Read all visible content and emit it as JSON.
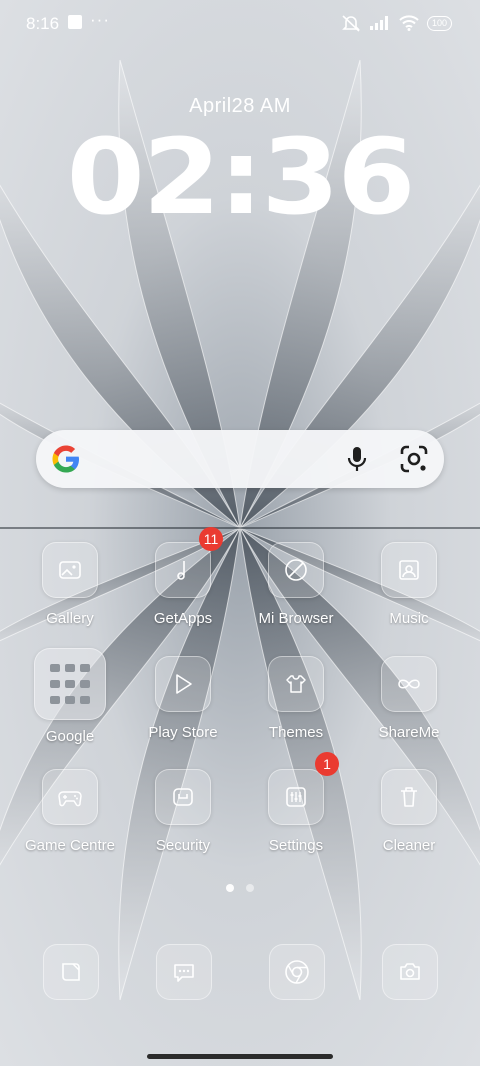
{
  "status": {
    "time": "8:16",
    "more": "···",
    "battery": "100"
  },
  "lockscreen": {
    "date": "April28  AM",
    "clock": "02:36"
  },
  "apps": [
    {
      "label": "Gallery",
      "icon": "gallery-icon"
    },
    {
      "label": "GetApps",
      "icon": "getapps-icon",
      "badge": "11"
    },
    {
      "label": "Mi Browser",
      "icon": "browser-icon"
    },
    {
      "label": "Music",
      "icon": "music-icon"
    },
    {
      "label": "Google",
      "icon": "google-folder-icon"
    },
    {
      "label": "Play Store",
      "icon": "play-store-icon"
    },
    {
      "label": "Themes",
      "icon": "themes-icon"
    },
    {
      "label": "ShareMe",
      "icon": "shareme-icon"
    },
    {
      "label": "Game Centre",
      "icon": "gamepad-icon"
    },
    {
      "label": "Security",
      "icon": "security-icon"
    },
    {
      "label": "Settings",
      "icon": "settings-icon",
      "badge": "1"
    },
    {
      "label": "Cleaner",
      "icon": "trash-icon"
    }
  ],
  "dock": [
    "phone-icon",
    "messages-icon",
    "chrome-icon",
    "camera-icon"
  ],
  "pager": {
    "pages": 2,
    "current": 1
  }
}
